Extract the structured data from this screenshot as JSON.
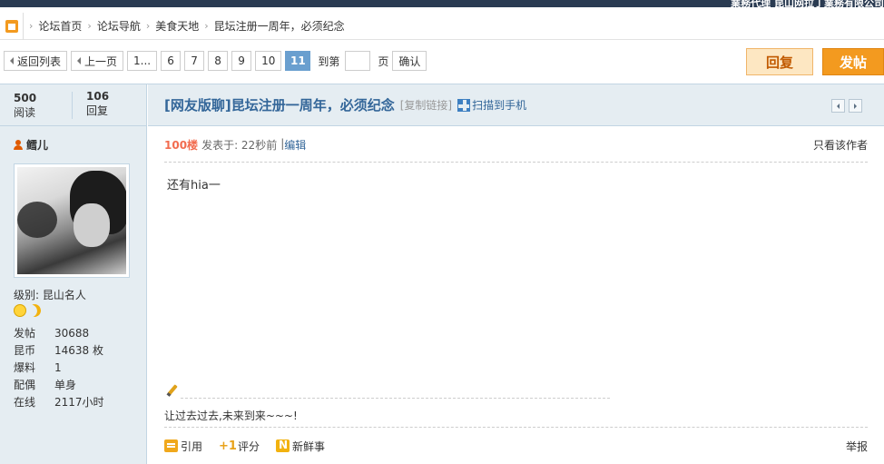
{
  "top_ad": "業務代理   昆山网拉丁業務有限公司",
  "breadcrumb": {
    "items": [
      "论坛首页",
      "论坛导航",
      "美食天地",
      "昆坛注册一周年，必须纪念"
    ]
  },
  "pager": {
    "back_label": "返回列表",
    "prev_label": "上一页",
    "first_label": "1...",
    "pages": [
      "6",
      "7",
      "8",
      "9",
      "10"
    ],
    "current": "11",
    "goto_label": "到第",
    "page_unit": "页",
    "confirm_label": "确认"
  },
  "buttons": {
    "reply": "回复",
    "post": "发帖"
  },
  "stats": {
    "views_value": "500",
    "views_label": "阅读",
    "replies_value": "106",
    "replies_label": "回复"
  },
  "thread": {
    "title": "[网友版聊]昆坛注册一周年，必须纪念",
    "copy_link": "[复制链接]",
    "scan_label": "扫描到手机"
  },
  "author": {
    "name": "鳕儿",
    "level_label": "级别:",
    "level_value": "昆山名人",
    "info": [
      {
        "k": "发帖",
        "v": "30688"
      },
      {
        "k": "昆币",
        "v": "14638 枚"
      },
      {
        "k": "爆料",
        "v": "1"
      },
      {
        "k": "配偶",
        "v": "单身"
      },
      {
        "k": "在线",
        "v": "2117小时"
      }
    ]
  },
  "post": {
    "floor": "100楼",
    "posted": "发表于: 22秒前",
    "separator": "|",
    "edit_label": "编辑",
    "only_author": "只看该作者",
    "content": "还有hia一",
    "signature": "让过去过去,未来到来~~~!"
  },
  "actions": {
    "quote": "引用",
    "rate": "评分",
    "fresh": "新鲜事",
    "report": "举报"
  },
  "colors": {
    "accent": "#f39a1f",
    "title": "#336699",
    "sidebar_bg": "#e5edf2",
    "floor": "#f26c4f"
  }
}
